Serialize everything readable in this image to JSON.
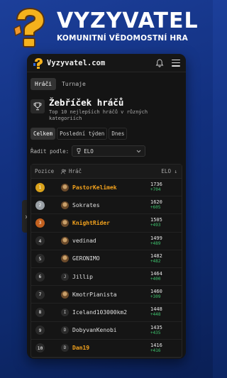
{
  "promo": {
    "title": "VYZYVATEL",
    "subtitle": "KOMUNITNÍ VĚDOMOSTNÍ HRA"
  },
  "app": {
    "name": "Vyzyvatel.com"
  },
  "tabs": [
    "Hráči",
    "Turnaje"
  ],
  "leaderboard": {
    "title": "Žebříček hráčů",
    "description": "Top 10 nejlepších hráčů v různých kategoriích"
  },
  "periods": [
    "Celkem",
    "Poslední týden",
    "Dnes"
  ],
  "sort": {
    "label": "Řadit podle:",
    "value": "ELO"
  },
  "table": {
    "headers": {
      "position": "Pozice",
      "player": "Hráč",
      "elo": "ELO"
    },
    "rows": [
      {
        "pos": "1",
        "name": "PastorKelimek",
        "elo": "1736",
        "delta": "+704",
        "highlight": true,
        "avatar": "",
        "rank_color": "#d9a21b"
      },
      {
        "pos": "2",
        "name": "Sokrates",
        "elo": "1620",
        "delta": "+605",
        "highlight": false,
        "avatar": "",
        "rank_color": "#9aa0a6"
      },
      {
        "pos": "3",
        "name": "KnightRider",
        "elo": "1505",
        "delta": "+493",
        "highlight": true,
        "avatar": "",
        "rank_color": "#c2601f"
      },
      {
        "pos": "4",
        "name": "vedinad",
        "elo": "1499",
        "delta": "+489",
        "highlight": false,
        "avatar": "",
        "rank_color": "#2a2a2a"
      },
      {
        "pos": "5",
        "name": "GERONIMO",
        "elo": "1482",
        "delta": "+482",
        "highlight": false,
        "avatar": "",
        "rank_color": "#2a2a2a"
      },
      {
        "pos": "6",
        "name": "Jillip",
        "elo": "1464",
        "delta": "+400",
        "highlight": false,
        "avatar": "J",
        "rank_color": "#2a2a2a"
      },
      {
        "pos": "7",
        "name": "KmotrPianista",
        "elo": "1460",
        "delta": "+309",
        "highlight": false,
        "avatar": "",
        "rank_color": "#2a2a2a"
      },
      {
        "pos": "8",
        "name": "Iceland103000km2",
        "elo": "1448",
        "delta": "+448",
        "highlight": false,
        "avatar": "I",
        "rank_color": "#2a2a2a"
      },
      {
        "pos": "9",
        "name": "DobyvanKenobi",
        "elo": "1435",
        "delta": "+435",
        "highlight": false,
        "avatar": "D",
        "rank_color": "#2a2a2a"
      },
      {
        "pos": "10",
        "name": "Dan19",
        "elo": "1416",
        "delta": "+416",
        "highlight": true,
        "avatar": "D",
        "rank_color": "#2a2a2a"
      }
    ]
  },
  "colors": {
    "accent_gold": "#f4a31d",
    "positive": "#3ec46d",
    "background": "#1c3f9a"
  }
}
